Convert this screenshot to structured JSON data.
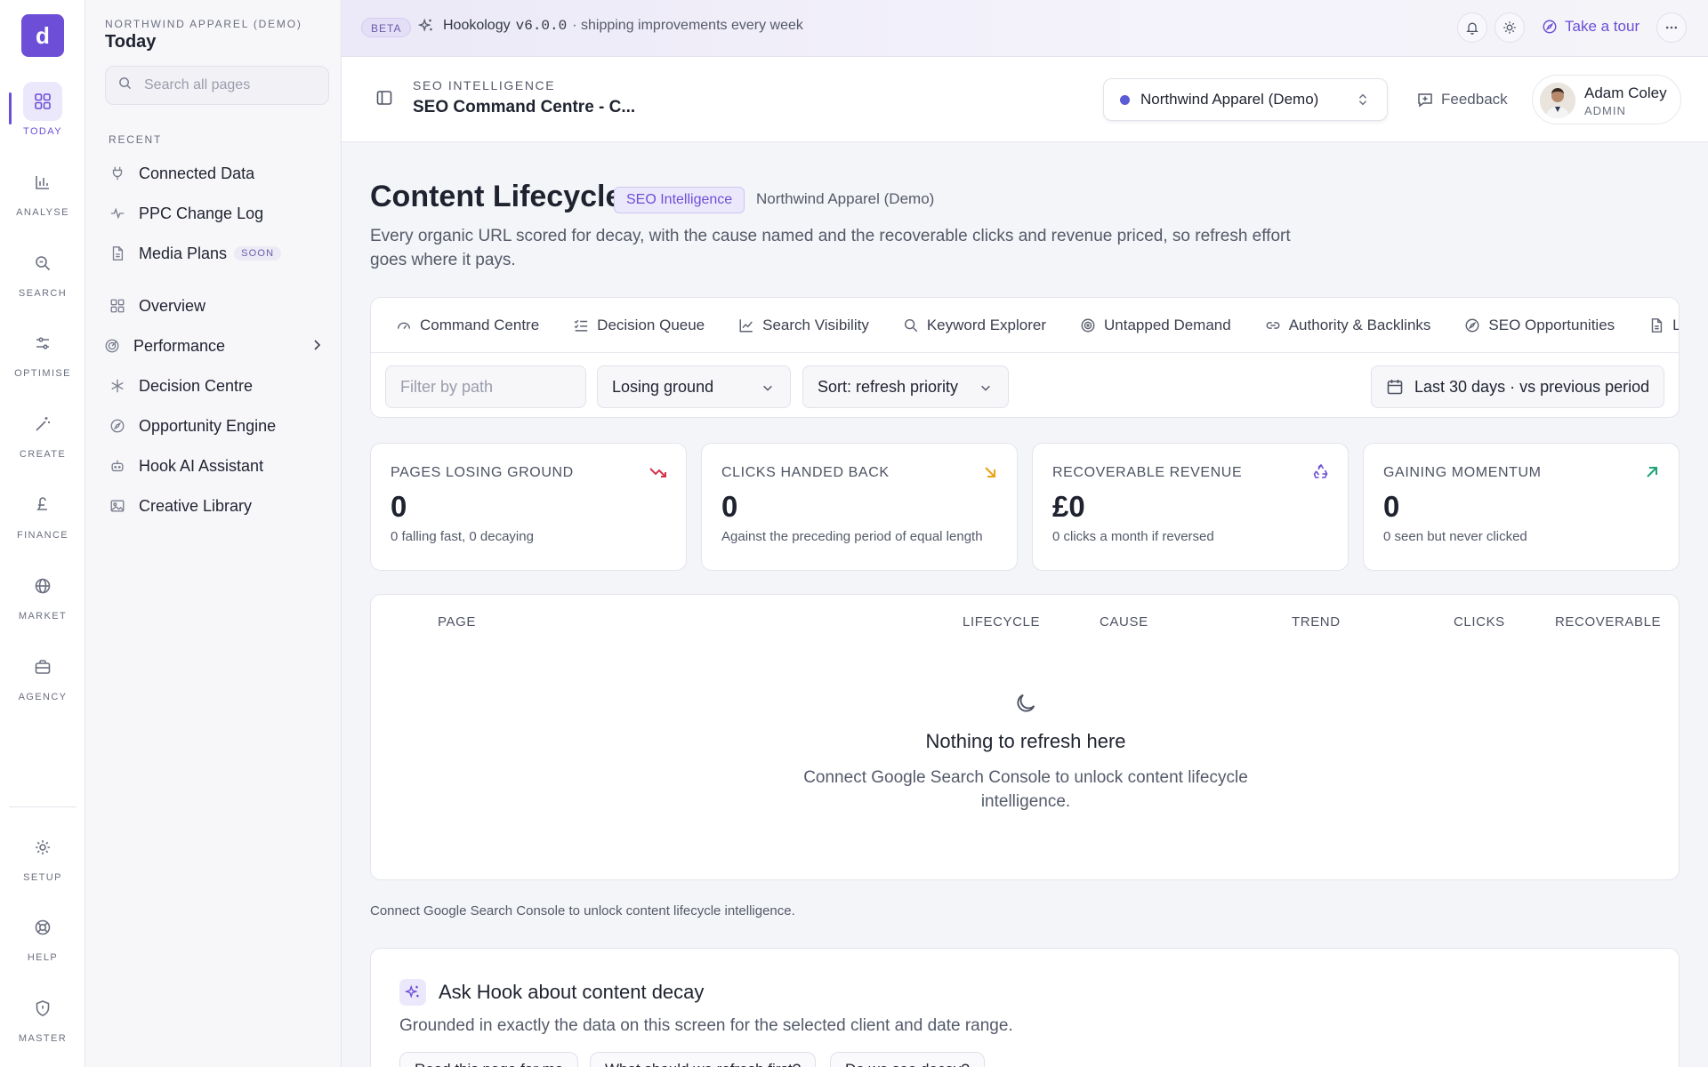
{
  "rail": {
    "logo_letter": "d",
    "items": [
      {
        "label": "TODAY",
        "icon": "dashboard-grid-icon"
      },
      {
        "label": "ANALYSE",
        "icon": "bar-chart-icon"
      },
      {
        "label": "SEARCH",
        "icon": "magnifier-icon"
      },
      {
        "label": "OPTIMISE",
        "icon": "sliders-icon"
      },
      {
        "label": "CREATE",
        "icon": "magic-wand-icon"
      },
      {
        "label": "FINANCE",
        "icon": "pound-icon"
      },
      {
        "label": "MARKET",
        "icon": "globe-icon"
      },
      {
        "label": "AGENCY",
        "icon": "briefcase-icon"
      },
      {
        "label": "SETUP",
        "icon": "gear-icon"
      },
      {
        "label": "HELP",
        "icon": "lifebuoy-icon"
      },
      {
        "label": "MASTER",
        "icon": "shield-icon"
      }
    ]
  },
  "side": {
    "org": "NORTHWIND APPAREL (DEMO)",
    "title": "Today",
    "search_placeholder": "Search all pages",
    "recent_label": "RECENT",
    "recent": [
      {
        "label": "Connected Data",
        "icon": "plug-icon"
      },
      {
        "label": "PPC Change Log",
        "icon": "pulse-icon"
      },
      {
        "label": "Media Plans",
        "icon": "document-icon",
        "badge": "SOON"
      }
    ],
    "items": [
      {
        "label": "Overview",
        "icon": "grid-icon"
      },
      {
        "label": "Performance",
        "icon": "target-icon"
      },
      {
        "label": "Decision Centre",
        "icon": "asterisk-icon"
      },
      {
        "label": "Opportunity Engine",
        "icon": "compass-icon"
      },
      {
        "label": "Hook AI Assistant",
        "icon": "robot-icon"
      },
      {
        "label": "Creative Library",
        "icon": "image-icon"
      }
    ]
  },
  "banner": {
    "beta": "BETA",
    "brand": "Hookology",
    "version": "v6.0.0",
    "tagline": "· shipping improvements every week",
    "tour": "Take a tour"
  },
  "header": {
    "kicker": "SEO INTELLIGENCE",
    "title": "SEO Command Centre - C...",
    "client": "Northwind Apparel (Demo)",
    "feedback": "Feedback",
    "user_name": "Adam Coley",
    "user_role": "ADMIN"
  },
  "page": {
    "title": "Content Lifecycle",
    "pill": "SEO Intelligence",
    "client": "Northwind Apparel (Demo)",
    "description": "Every organic URL scored for decay, with the cause named and the recoverable clicks and revenue priced, so refresh effort goes where it pays."
  },
  "tabs": [
    {
      "label": "Command Centre",
      "icon": "gauge-icon"
    },
    {
      "label": "Decision Queue",
      "icon": "checklist-icon"
    },
    {
      "label": "Search Visibility",
      "icon": "line-chart-icon"
    },
    {
      "label": "Keyword Explorer",
      "icon": "search-icon"
    },
    {
      "label": "Untapped Demand",
      "icon": "target-icon"
    },
    {
      "label": "Authority & Backlinks",
      "icon": "link-icon"
    },
    {
      "label": "SEO Opportunities",
      "icon": "compass-icon"
    },
    {
      "label": "L",
      "icon": "document-icon"
    }
  ],
  "filters": {
    "path_placeholder": "Filter by path",
    "status": "Losing ground",
    "sort": "Sort: refresh priority",
    "date_range": "Last 30 days · vs previous period"
  },
  "kpis": [
    {
      "label": "PAGES LOSING GROUND",
      "value": "0",
      "sub": "0 falling fast, 0 decaying",
      "icon": "trend-down-icon",
      "color": "#d6334a"
    },
    {
      "label": "CLICKS HANDED BACK",
      "value": "0",
      "sub": "Against the preceding period of equal length",
      "icon": "arrow-down-right-icon",
      "color": "#e8a317"
    },
    {
      "label": "RECOVERABLE REVENUE",
      "value": "£0",
      "sub": "0 clicks a month if reversed",
      "icon": "recycle-icon",
      "color": "#6c4fd6"
    },
    {
      "label": "GAINING MOMENTUM",
      "value": "0",
      "sub": "0 seen but never clicked",
      "icon": "arrow-up-right-icon",
      "color": "#1fa37a"
    }
  ],
  "table": {
    "columns": [
      "PAGE",
      "LIFECYCLE",
      "CAUSE",
      "TREND",
      "CLICKS",
      "RECOVERABLE"
    ],
    "empty_title": "Nothing to refresh here",
    "empty_desc": "Connect Google Search Console to unlock content lifecycle intelligence."
  },
  "footnote": "Connect Google Search Console to unlock content lifecycle intelligence.",
  "ask": {
    "title": "Ask Hook about content decay",
    "subtitle": "Grounded in exactly the data on this screen for the selected client and date range.",
    "chips": [
      "Read this page for me",
      "What should we refresh first?",
      "Do we see decay?"
    ]
  },
  "colors": {
    "accent": "#6c4fd6"
  }
}
